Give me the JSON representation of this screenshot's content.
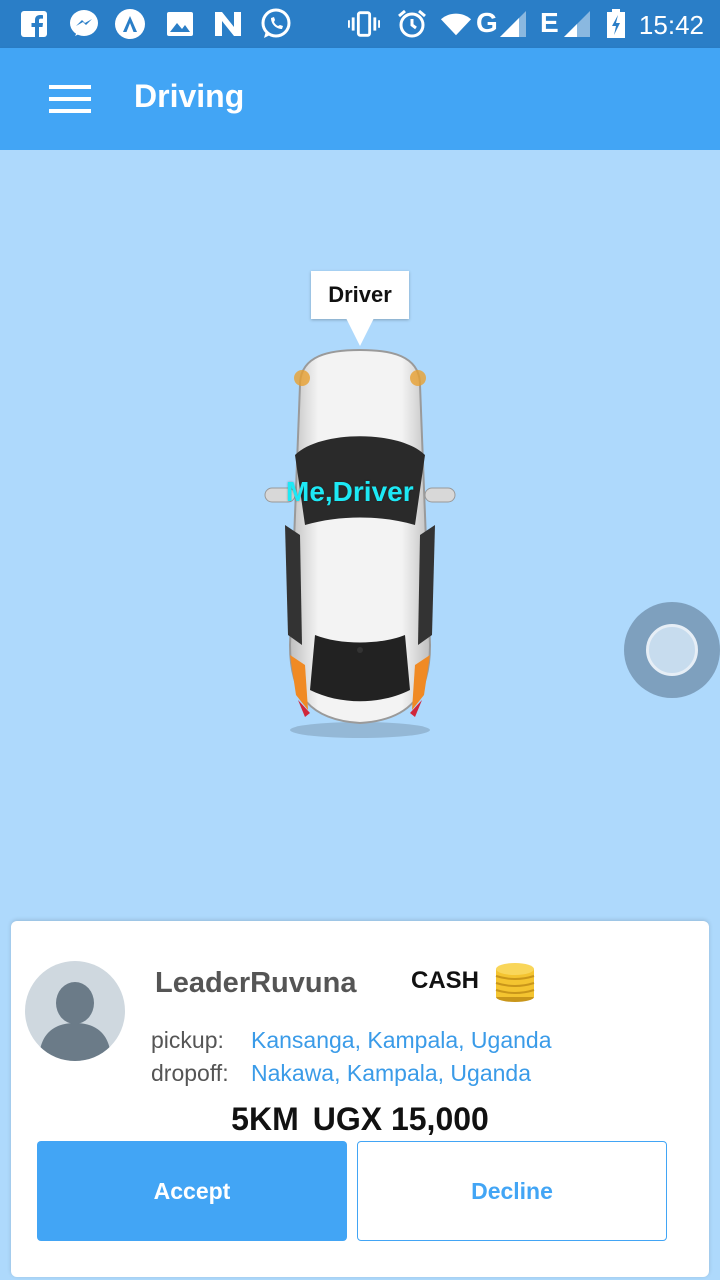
{
  "status_bar": {
    "time": "15:42",
    "network_g": "G",
    "network_e": "E",
    "icons": [
      "facebook-icon",
      "messenger-icon",
      "app-a-icon",
      "gallery-icon",
      "n-app-icon",
      "whatsapp-icon",
      "vibrate-icon",
      "alarm-icon",
      "wifi-icon",
      "signal-icon",
      "signal-icon",
      "battery-charging-icon"
    ]
  },
  "app_bar": {
    "title": "Driving"
  },
  "map": {
    "marker_tooltip": "Driver",
    "car_label": "Me,Driver"
  },
  "request": {
    "rider_name": "LeaderRuvuna",
    "payment_method": "CASH",
    "pickup_label": "pickup:",
    "pickup_value": "Kansanga, Kampala, Uganda",
    "dropoff_label": "dropoff:",
    "dropoff_value": "Nakawa, Kampala, Uganda",
    "distance": "5KM",
    "fare": "UGX 15,000",
    "accept_label": "Accept",
    "decline_label": "Decline"
  },
  "colors": {
    "status_bar": "#2a7ec7",
    "app_bar": "#42a5f5",
    "map_bg": "#aed9fc",
    "link_blue": "#3a9be8",
    "car_label": "#1de9f5"
  }
}
